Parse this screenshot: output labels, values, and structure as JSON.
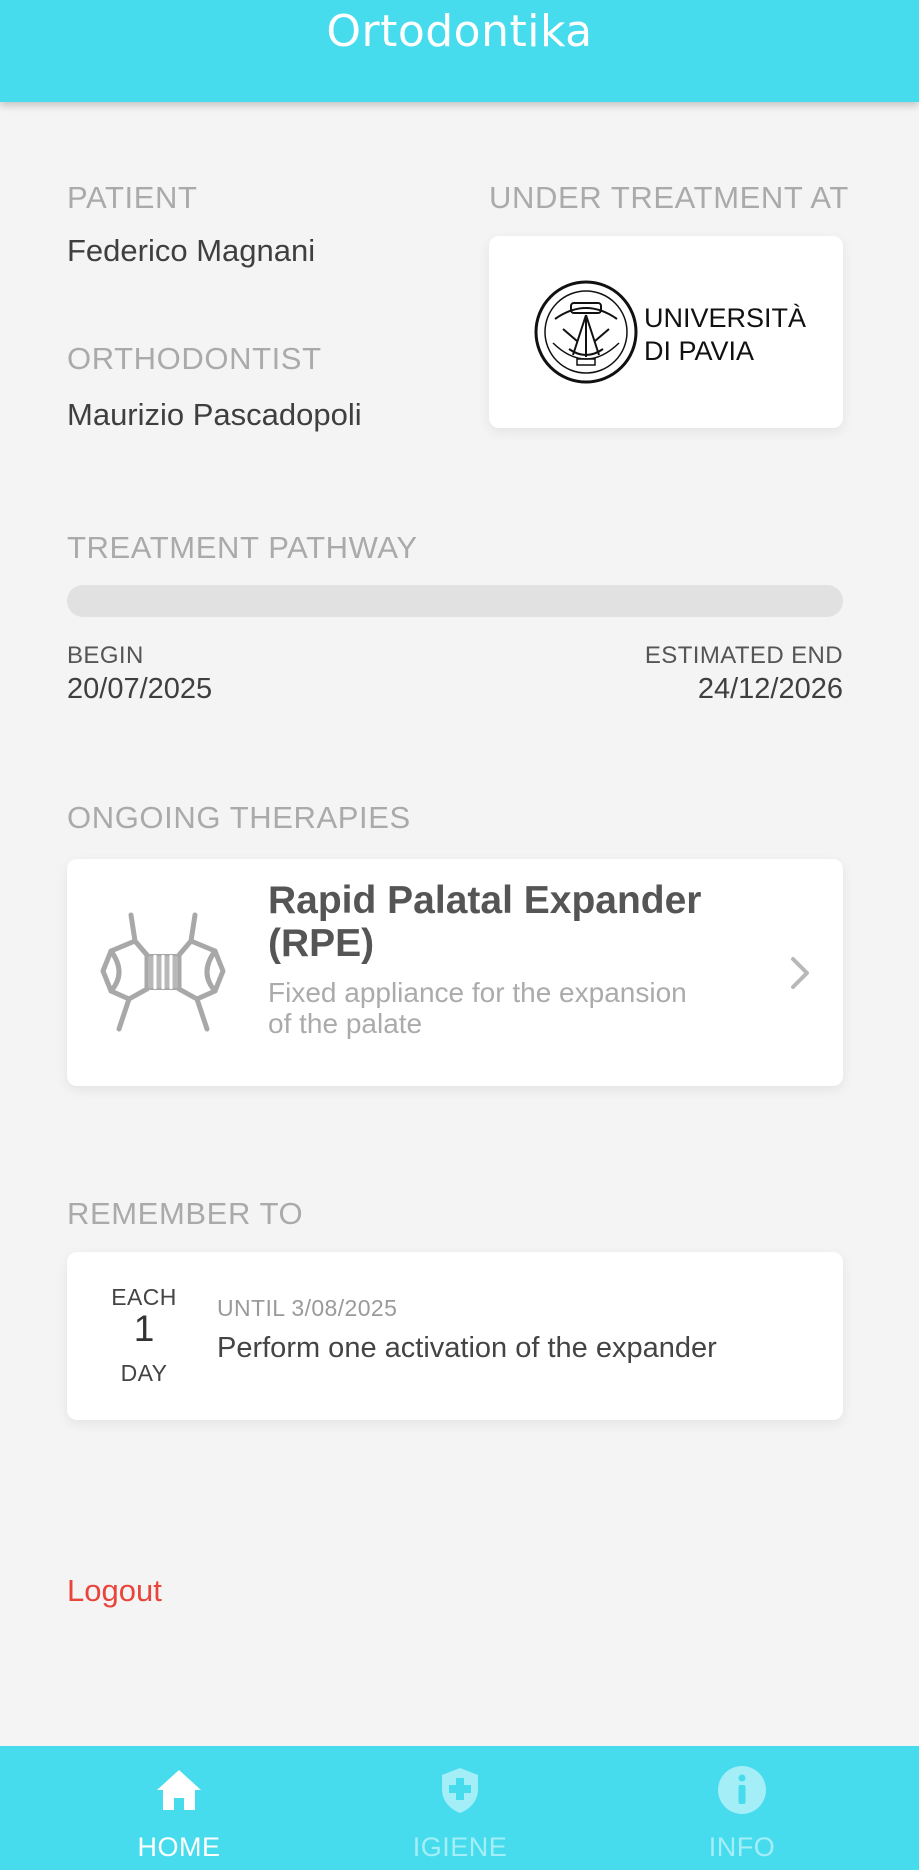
{
  "app": {
    "title": "Ortodontika"
  },
  "patient": {
    "label": "PATIENT",
    "name": "Federico Magnani"
  },
  "orthodontist": {
    "label": "ORTHODONTIST",
    "name": "Maurizio Pascadopoli"
  },
  "treatment_center": {
    "label": "UNDER TREATMENT AT",
    "logo_line1": "UNIVERSITÀ",
    "logo_line2": "DI PAVIA",
    "logo_icon": "university-seal-icon"
  },
  "pathway": {
    "label": "TREATMENT PATHWAY",
    "progress_percent": 0,
    "begin_label": "BEGIN",
    "begin_date": "20/07/2025",
    "end_label": "ESTIMATED END",
    "end_date": "24/12/2026"
  },
  "therapies": {
    "label": "ONGOING THERAPIES",
    "items": [
      {
        "title": "Rapid Palatal Expander (RPE)",
        "description": "Fixed appliance for the expansion of the palate",
        "icon": "palatal-expander-icon"
      }
    ]
  },
  "reminders": {
    "label": "REMEMBER TO",
    "items": [
      {
        "frequency_prefix": "EACH",
        "frequency_count": "1",
        "frequency_unit": "DAY",
        "until": "UNTIL 3/08/2025",
        "text": "Perform one activation of the expander"
      }
    ]
  },
  "logout_label": "Logout",
  "nav": {
    "items": [
      {
        "label": "HOME",
        "icon": "home-icon",
        "active": true
      },
      {
        "label": "IGIENE",
        "icon": "shield-plus-icon",
        "active": false
      },
      {
        "label": "INFO",
        "icon": "info-icon",
        "active": false
      }
    ]
  },
  "colors": {
    "accent": "#46dcee",
    "background": "#f4f4f4",
    "logout": "#e8453c",
    "label_gray": "#aaaaaa"
  }
}
